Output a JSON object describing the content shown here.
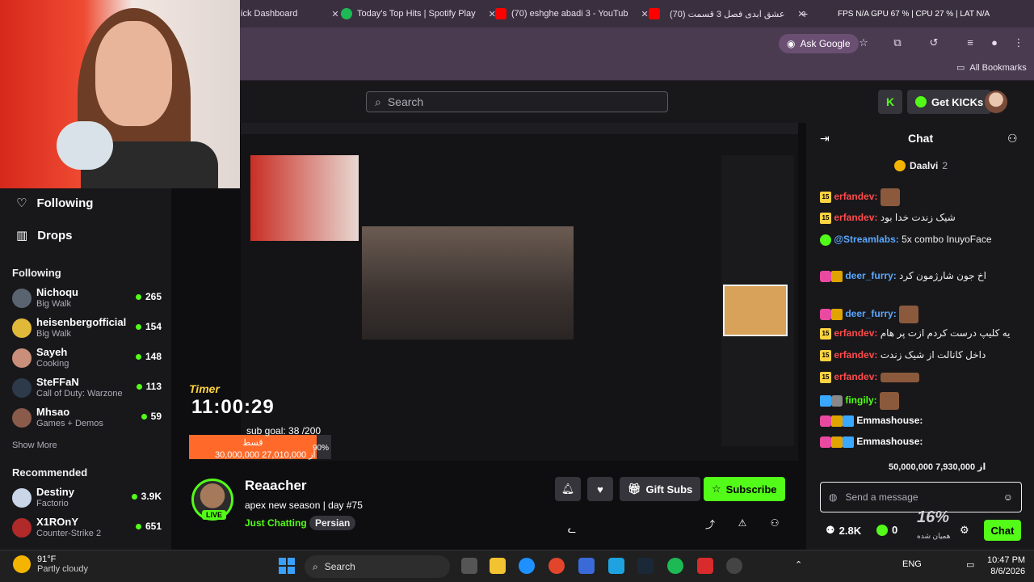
{
  "browser": {
    "tabs": [
      {
        "label": "ick Dashboard"
      },
      {
        "label": "Today's Top Hits | Spotify Play"
      },
      {
        "label": "(70) eshghe abadi 3 - YouTub"
      },
      {
        "label": "(70) عشق ابدی فصل 3 قسمت"
      }
    ],
    "perf": "FPS  N/A   GPU 67 %  |  CPU 27 %  |  LAT  N/A",
    "ask_google": "Ask Google",
    "all_bookmarks": "All Bookmarks"
  },
  "header": {
    "search_placeholder": "Search",
    "get_kicks": "Get KICKs"
  },
  "sidebar": {
    "nav": [
      {
        "label": "Following"
      },
      {
        "label": "Drops"
      }
    ],
    "following_heading": "Following",
    "following": [
      {
        "name": "Nichoqu",
        "category": "Big Walk",
        "viewers": "265"
      },
      {
        "name": "heisenbergofficial",
        "category": "Big Walk",
        "viewers": "154"
      },
      {
        "name": "Sayeh",
        "category": "Cooking",
        "viewers": "148"
      },
      {
        "name": "SteFFaN",
        "category": "Call of Duty: Warzone",
        "viewers": "113"
      },
      {
        "name": "Mhsao",
        "category": "Games + Demos",
        "viewers": "59"
      }
    ],
    "show_more": "Show More",
    "recommended_heading": "Recommended",
    "recommended": [
      {
        "name": "Destiny",
        "category": "Factorio",
        "viewers": "3.9K"
      },
      {
        "name": "X1ROnY",
        "category": "Counter-Strike 2",
        "viewers": "651"
      }
    ]
  },
  "overlay": {
    "timer_label": "Timer",
    "timer": "11:00:29",
    "sub_goal": "sub goal: 38 /200",
    "goal_progress_percent": 90,
    "goal_percent_label": "90%",
    "goal_word": "قسط",
    "goal_amount": "30,000,000 از 27,010,000"
  },
  "stream": {
    "streamer": "Reaacher",
    "live": "LIVE",
    "title": "apex new season | day #75",
    "category": "Just Chatting",
    "tag": "Persian",
    "gift_subs": "Gift Subs",
    "subscribe": "Subscribe"
  },
  "chat": {
    "title": "Chat",
    "pinned_user": "Daalvi",
    "pinned_count": "2",
    "messages": [
      {
        "user": "erfandev:",
        "text": ""
      },
      {
        "user": "erfandev:",
        "text": "شیک زندت خدا بود"
      },
      {
        "user": "@Streamlabs:",
        "text": "5x  combo InuyoFace"
      },
      {
        "user": "deer_furry:",
        "text": "اخ جون شارژمون کرد"
      },
      {
        "user": "deer_furry:",
        "text": ""
      },
      {
        "user": "erfandev:",
        "text": "یه کلیپ درست کردم ازت پر هام"
      },
      {
        "user": "erfandev:",
        "text": "داخل کانالت از شیک زندت"
      },
      {
        "user": "erfandev:",
        "text": ""
      },
      {
        "user": "fingily:",
        "text": ""
      },
      {
        "user": "Emmashouse:",
        "text": ""
      },
      {
        "user": "Emmashouse:",
        "text": ""
      }
    ],
    "overlay_goal": "50,000,000 از 7,930,000",
    "send_placeholder": "Send a message",
    "viewers": "2.8K",
    "kicks": "0",
    "chat_button": "Chat",
    "overlay_percent": "16%",
    "overlay_sub": "همیان شده"
  },
  "taskbar": {
    "temp": "91°F",
    "weather": "Partly cloudy",
    "search": "Search",
    "lang": "ENG",
    "time": "10:47 PM",
    "date": "8/6/2026"
  },
  "colors": {
    "kick_green": "#53fc18",
    "bg": "#0e0e10",
    "panel": "#18181b"
  }
}
